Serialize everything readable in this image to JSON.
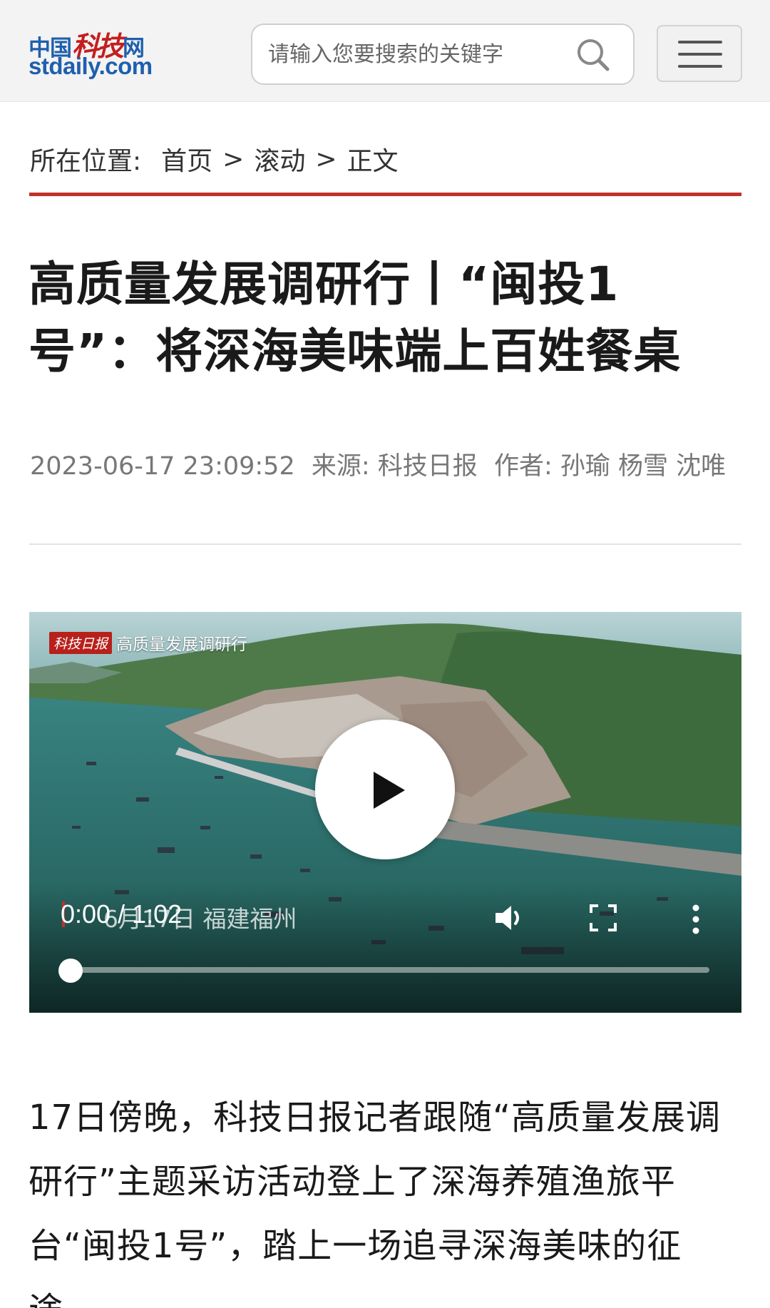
{
  "header": {
    "logo_cn_prefix": "中国",
    "logo_cn_brand": "科技",
    "logo_cn_suffix": "网",
    "logo_url": "stdaily.com",
    "search_placeholder": "请输入您要搜索的关键字",
    "search_icon": "search-icon",
    "menu_icon": "hamburger-menu-icon"
  },
  "breadcrumb": {
    "label": "所在位置:",
    "items": [
      "首页",
      "滚动",
      "正文"
    ],
    "separator": ">"
  },
  "article": {
    "title": "高质量发展调研行丨“闽投1号”：将深海美味端上百姓餐桌",
    "datetime": "2023-06-17 23:09:52",
    "source": "来源: 科技日报",
    "author": "作者: 孙瑜 杨雪 沈唯",
    "body": "17日傍晚，科技日报记者跟随“高质量发展调研行”主题采访活动登上了深海养殖渔旅平台“闽投1号”，踏上一场追寻深海美味的征途。"
  },
  "video": {
    "badge_logo": "科技日报",
    "badge_title": "高质量发展调研行",
    "caption": "6月17日 福建福州",
    "time_display": "0:00 / 1:02",
    "progress": 0,
    "play_icon": "play-icon",
    "volume_icon": "volume-icon",
    "fullscreen_icon": "fullscreen-icon",
    "more_icon": "more-vertical-icon"
  },
  "colors": {
    "brand_blue": "#1f5fae",
    "brand_red": "#c41e1e",
    "rule_red": "#c0312b"
  }
}
